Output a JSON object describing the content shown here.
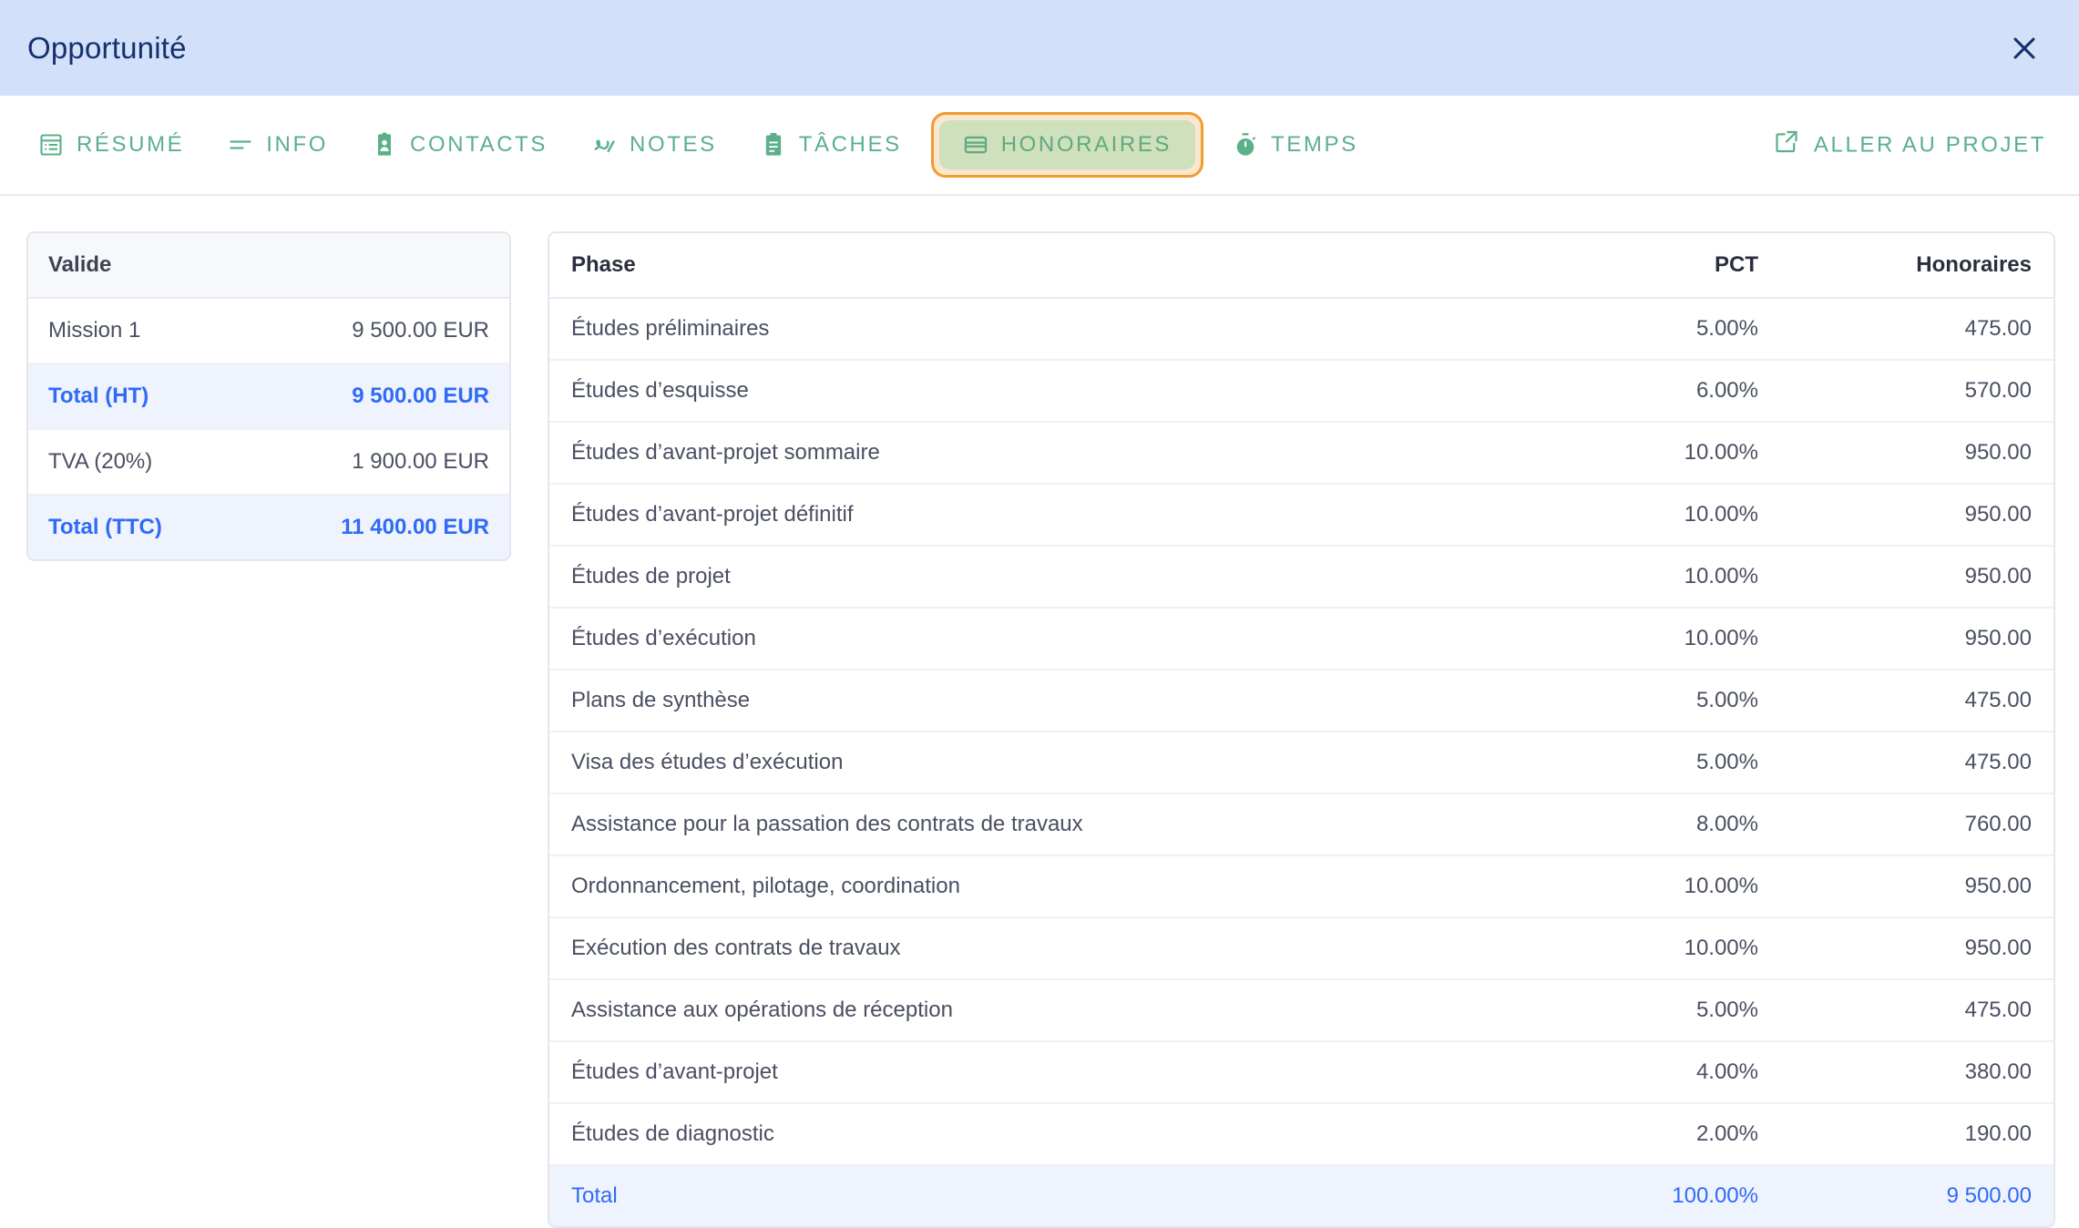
{
  "dialog": {
    "title": "Opportunité",
    "close_icon": "close-icon"
  },
  "tabs": [
    {
      "label": "Résumé",
      "icon": "list-table-icon",
      "active": false
    },
    {
      "label": "Info",
      "icon": "lines-icon",
      "active": false
    },
    {
      "label": "Contacts",
      "icon": "contact-card-icon",
      "active": false
    },
    {
      "label": "Notes",
      "icon": "squiggle-icon",
      "active": false
    },
    {
      "label": "Tâches",
      "icon": "clipboard-icon",
      "active": false
    },
    {
      "label": "Honoraires",
      "icon": "credit-card-icon",
      "active": true
    },
    {
      "label": "Temps",
      "icon": "stopwatch-icon",
      "active": false
    }
  ],
  "goto_project": {
    "label": "Aller au projet",
    "icon": "external-link-icon"
  },
  "summary": {
    "header": "Valide",
    "rows": [
      {
        "label": "Mission 1",
        "value": "9 500.00 EUR",
        "highlight": false
      },
      {
        "label": "Total (HT)",
        "value": "9 500.00 EUR",
        "highlight": true
      },
      {
        "label": "TVA (20%)",
        "value": "1 900.00 EUR",
        "highlight": false
      },
      {
        "label": "Total (TTC)",
        "value": "11 400.00 EUR",
        "highlight": true
      }
    ]
  },
  "fees_table": {
    "columns": {
      "phase": "Phase",
      "pct": "PCT",
      "fee": "Honoraires"
    },
    "rows": [
      {
        "phase": "Études préliminaires",
        "pct": "5.00%",
        "fee": "475.00"
      },
      {
        "phase": "Études d’esquisse",
        "pct": "6.00%",
        "fee": "570.00"
      },
      {
        "phase": "Études d’avant-projet sommaire",
        "pct": "10.00%",
        "fee": "950.00"
      },
      {
        "phase": "Études d’avant-projet définitif",
        "pct": "10.00%",
        "fee": "950.00"
      },
      {
        "phase": "Études de projet",
        "pct": "10.00%",
        "fee": "950.00"
      },
      {
        "phase": "Études d’exécution",
        "pct": "10.00%",
        "fee": "950.00"
      },
      {
        "phase": "Plans de synthèse",
        "pct": "5.00%",
        "fee": "475.00"
      },
      {
        "phase": "Visa des études d’exécution",
        "pct": "5.00%",
        "fee": "475.00"
      },
      {
        "phase": "Assistance pour la passation des contrats de travaux",
        "pct": "8.00%",
        "fee": "760.00"
      },
      {
        "phase": "Ordonnancement, pilotage, coordination",
        "pct": "10.00%",
        "fee": "950.00"
      },
      {
        "phase": "Exécution des contrats de travaux",
        "pct": "10.00%",
        "fee": "950.00"
      },
      {
        "phase": "Assistance aux opérations de réception",
        "pct": "5.00%",
        "fee": "475.00"
      },
      {
        "phase": "Études d’avant-projet",
        "pct": "4.00%",
        "fee": "380.00"
      },
      {
        "phase": "Études de diagnostic",
        "pct": "2.00%",
        "fee": "190.00"
      }
    ],
    "total": {
      "phase": "Total",
      "pct": "100.00%",
      "fee": "9 500.00"
    }
  },
  "colors": {
    "header_bg": "#d3e0fa",
    "header_text": "#15306b",
    "tab_green": "#5bb08a",
    "active_tab_bg": "#cfe0bd",
    "active_tab_ring": "#fbe7cd",
    "active_tab_border": "#f29b2e",
    "total_blue": "#2f6bf5",
    "total_row_bg": "#eff3fd",
    "border": "#e4e6ef"
  }
}
